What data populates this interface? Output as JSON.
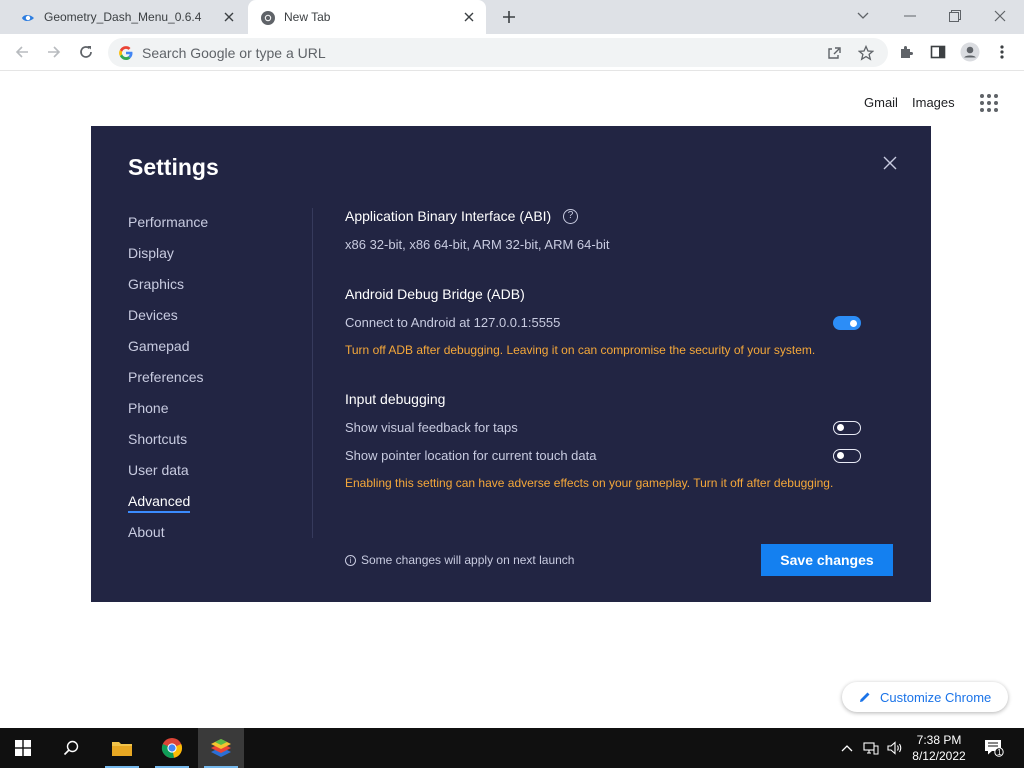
{
  "browser": {
    "tabs": [
      {
        "title": "Geometry_Dash_Menu_0.6.4",
        "icon": "bluestacks-favicon-icon",
        "active": false
      },
      {
        "title": "New Tab",
        "icon": "chrome-icon",
        "active": true
      }
    ],
    "omnibox_placeholder": "Search Google or type a URL"
  },
  "ntp": {
    "gmail": "Gmail",
    "images": "Images",
    "customize": "Customize Chrome"
  },
  "settings": {
    "title": "Settings",
    "nav": [
      {
        "label": "Performance",
        "active": false
      },
      {
        "label": "Display",
        "active": false
      },
      {
        "label": "Graphics",
        "active": false
      },
      {
        "label": "Devices",
        "active": false
      },
      {
        "label": "Gamepad",
        "active": false
      },
      {
        "label": "Preferences",
        "active": false
      },
      {
        "label": "Phone",
        "active": false
      },
      {
        "label": "Shortcuts",
        "active": false
      },
      {
        "label": "User data",
        "active": false
      },
      {
        "label": "Advanced",
        "active": true
      },
      {
        "label": "About",
        "active": false
      }
    ],
    "abi": {
      "title": "Application Binary Interface (ABI)",
      "help": "?",
      "value": "x86 32-bit, x86 64-bit, ARM 32-bit, ARM 64-bit"
    },
    "adb": {
      "title": "Android Debug Bridge (ADB)",
      "label": "Connect to Android at 127.0.0.1:5555",
      "enabled": true,
      "warning": "Turn off ADB after debugging. Leaving it on can compromise the security of your system."
    },
    "input_debugging": {
      "title": "Input debugging",
      "options": [
        {
          "label": "Show visual feedback for taps",
          "enabled": false
        },
        {
          "label": "Show pointer location for current touch data",
          "enabled": false
        }
      ],
      "warning": "Enabling this setting can have adverse effects on your gameplay. Turn it off after debugging."
    },
    "note": "Some changes will apply on next launch",
    "save_label": "Save changes"
  },
  "taskbar": {
    "time": "7:38 PM",
    "date": "8/12/2022",
    "notification_count": "1"
  },
  "colors": {
    "dialog_bg": "#222543",
    "accent": "#1480f0",
    "warning": "#f5a83a"
  }
}
